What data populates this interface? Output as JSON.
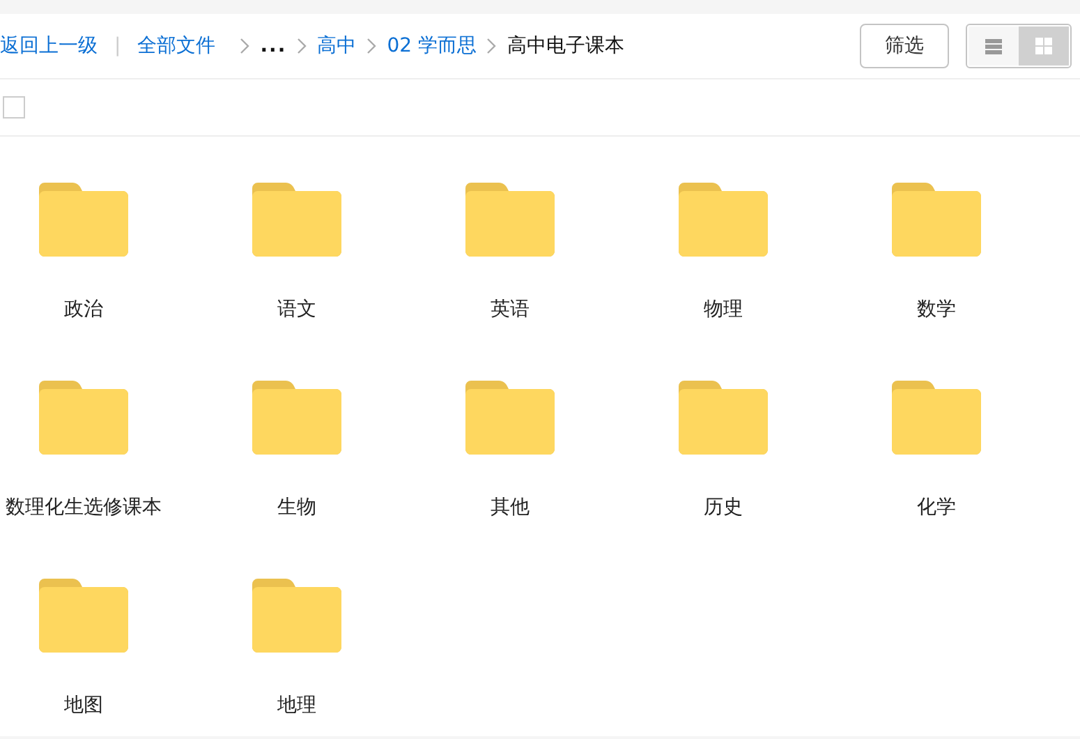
{
  "toolbar": {
    "back_link": "返回上一级",
    "separator": "|",
    "breadcrumbs": [
      {
        "label": "全部文件",
        "kind": "link"
      },
      {
        "label": "...",
        "kind": "ellipsis"
      },
      {
        "label": "高中",
        "kind": "link"
      },
      {
        "label": "02 学而思",
        "kind": "link"
      },
      {
        "label": "高中电子课本",
        "kind": "current"
      }
    ],
    "filter_button": "筛选",
    "view_toggle": [
      {
        "kind": "list",
        "selected": false
      },
      {
        "kind": "grid",
        "selected": true
      }
    ]
  },
  "select_all": {
    "checked": false
  },
  "folders": [
    {
      "name": "政治"
    },
    {
      "name": "语文"
    },
    {
      "name": "英语"
    },
    {
      "name": "物理"
    },
    {
      "name": "数学"
    },
    {
      "name": "数理化生选修课本"
    },
    {
      "name": "生物"
    },
    {
      "name": "其他"
    },
    {
      "name": "历史"
    },
    {
      "name": "化学"
    },
    {
      "name": "地图"
    },
    {
      "name": "地理"
    }
  ]
}
